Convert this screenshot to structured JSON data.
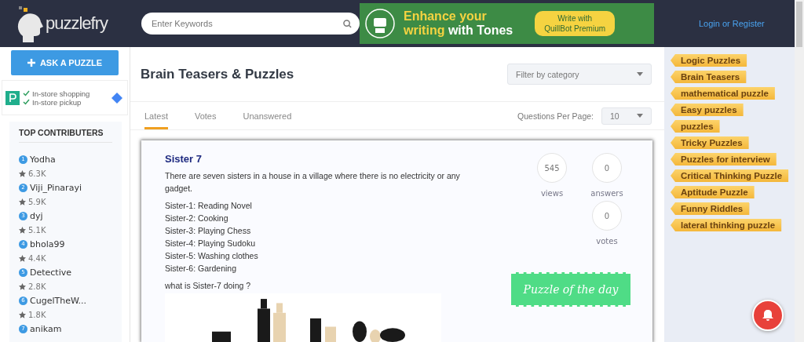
{
  "header": {
    "logo": "puzzlefry",
    "search": {
      "placeholder": "Enter Keywords"
    },
    "ad": {
      "headline_1": "Enhance your",
      "headline_2a": "writing",
      "headline_2b": "with Tones",
      "cta_1": "Write with",
      "cta_2": "QuillBot Premium"
    },
    "login": "Login or Register"
  },
  "sidebar": {
    "ask_button": "ASK A PUZZLE",
    "ad": {
      "lines": [
        "In-store shopping",
        "In-store pickup"
      ]
    },
    "contributors_title": "TOP CONTRIBUTERS",
    "contributors": [
      {
        "rank": "1",
        "name": "Yodha",
        "score": "6.3K"
      },
      {
        "rank": "2",
        "name": "Viji_Pinarayi",
        "score": "5.9K"
      },
      {
        "rank": "3",
        "name": "dyj",
        "score": "5.1K"
      },
      {
        "rank": "4",
        "name": "bhola99",
        "score": "4.4K"
      },
      {
        "rank": "5",
        "name": "Detective",
        "score": "2.8K"
      },
      {
        "rank": "6",
        "name": "CugelTheW...",
        "score": "1.8K"
      },
      {
        "rank": "7",
        "name": "anikam"
      }
    ]
  },
  "main": {
    "title": "Brain Teasers & Puzzles",
    "filter": {
      "placeholder": "Filter by category"
    },
    "tabs": [
      {
        "label": "Latest",
        "selected": true
      },
      {
        "label": "Votes",
        "selected": false
      },
      {
        "label": "Unanswered",
        "selected": false
      }
    ],
    "per_page_label": "Questions Per Page:",
    "per_page_value": "10",
    "question": {
      "title": "Sister 7",
      "intro": "There are seven sisters in a house in a village where there is no electricity or any gadget.",
      "lines": [
        "Sister-1: Reading Novel",
        "Sister-2: Cooking",
        "Sister-3: Playing Chess",
        "Sister-4: Playing Sudoku",
        "Sister-5: Washing clothes",
        "Sister-6: Gardening"
      ],
      "ask": "what is Sister-7 doing ?",
      "views": "545",
      "views_label": "views",
      "answers": "0",
      "answers_label": "answers",
      "votes": "0",
      "votes_label": "votes",
      "ribbon": "Puzzle of the day"
    }
  },
  "tags": [
    "Logic Puzzles",
    "Brain Teasers",
    "mathematical puzzle",
    "Easy puzzles",
    "puzzles",
    "Tricky Puzzles",
    "Puzzles for interview",
    "Critical Thinking Puzzle",
    "Aptitude Puzzle",
    "Funny Riddles",
    "lateral thinking puzzle"
  ]
}
